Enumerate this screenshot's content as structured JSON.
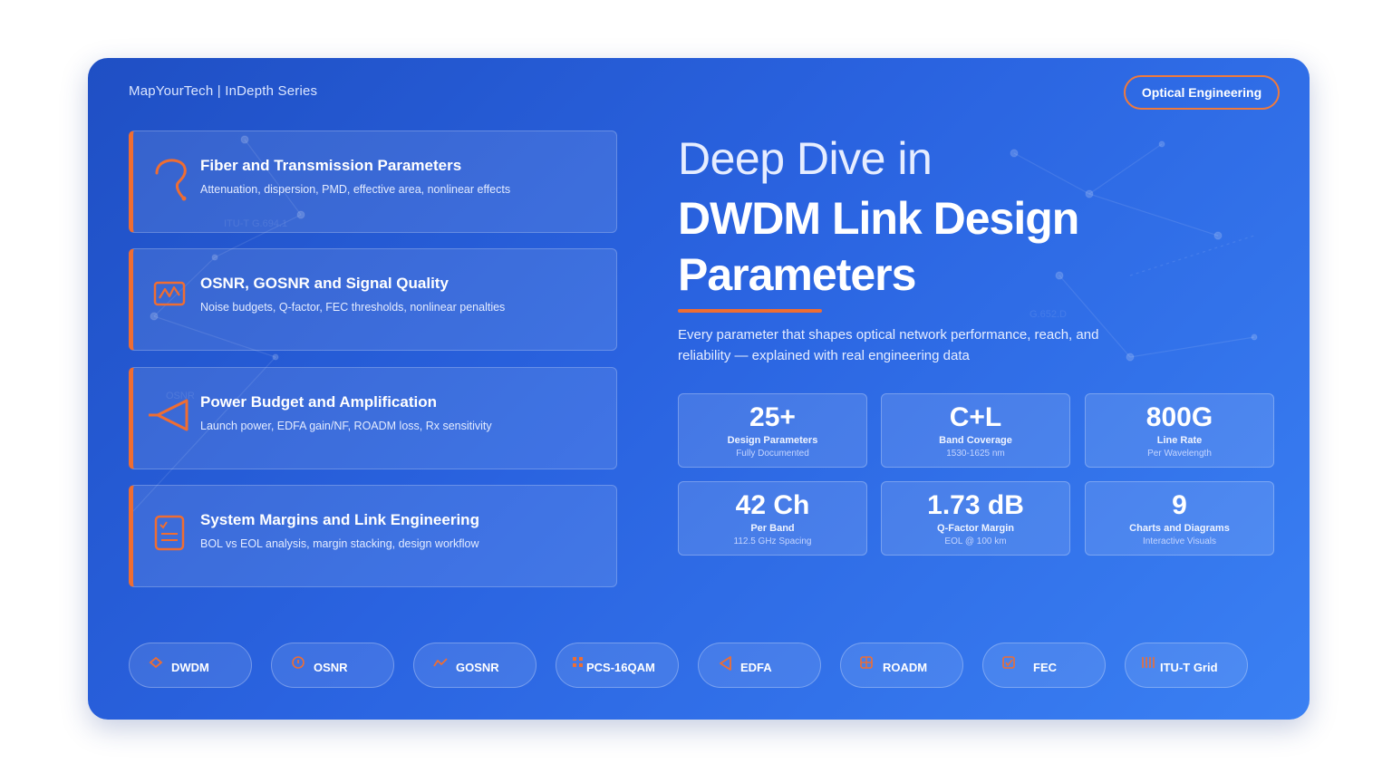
{
  "brand": "MapYourTech | InDepth Series",
  "badge": "Optical Engineering",
  "topics": [
    {
      "title": "Fiber and Transmission Parameters",
      "subtitle": "Attenuation, dispersion, PMD, effective area, nonlinear effects",
      "icon": "fiber-hook-icon"
    },
    {
      "title": "OSNR, GOSNR and Signal Quality",
      "subtitle": "Noise budgets, Q-factor, FEC thresholds, nonlinear penalties",
      "icon": "signal-waveform-icon"
    },
    {
      "title": "Power Budget and Amplification",
      "subtitle": "Launch power, EDFA gain/NF, ROADM loss, Rx sensitivity",
      "icon": "amplifier-triangle-icon"
    },
    {
      "title": "System Margins and Link Engineering",
      "subtitle": "BOL vs EOL analysis, margin stacking, design workflow",
      "icon": "checklist-icon"
    }
  ],
  "heading": {
    "line1": "Deep Dive in",
    "line2": "DWDM Link Design",
    "line3": "Parameters"
  },
  "lead": "Every parameter that shapes optical network performance, reach, and reliability — explained with real engineering data",
  "stats": [
    {
      "value": "25+",
      "label": "Design Parameters",
      "sub": "Fully Documented"
    },
    {
      "value": "C+L",
      "label": "Band Coverage",
      "sub": "1530-1625 nm"
    },
    {
      "value": "800G",
      "label": "Line Rate",
      "sub": "Per Wavelength"
    },
    {
      "value": "42 Ch",
      "label": "Per Band",
      "sub": "112.5 GHz Spacing"
    },
    {
      "value": "1.73 dB",
      "label": "Q-Factor Margin",
      "sub": "EOL @ 100 km"
    },
    {
      "value": "9",
      "label": "Charts and Diagrams",
      "sub": "Interactive Visuals"
    }
  ],
  "tags": [
    {
      "label": "DWDM",
      "icon": "diamond-icon"
    },
    {
      "label": "OSNR",
      "icon": "info-circle-icon"
    },
    {
      "label": "GOSNR",
      "icon": "trend-line-icon"
    },
    {
      "label": "PCS-16QAM",
      "icon": "constellation-dots-icon"
    },
    {
      "label": "EDFA",
      "icon": "amplifier-triangle-icon"
    },
    {
      "label": "ROADM",
      "icon": "switch-grid-icon"
    },
    {
      "label": "FEC",
      "icon": "check-box-icon"
    },
    {
      "label": "ITU-T Grid",
      "icon": "grid-bars-icon"
    }
  ],
  "watermarks": [
    "ITU-T G.694.1",
    "G.652.D",
    "OSNR"
  ],
  "colors": {
    "accent": "#ef6d32",
    "background_start": "#1f4fc4",
    "background_end": "#3a80f3"
  }
}
